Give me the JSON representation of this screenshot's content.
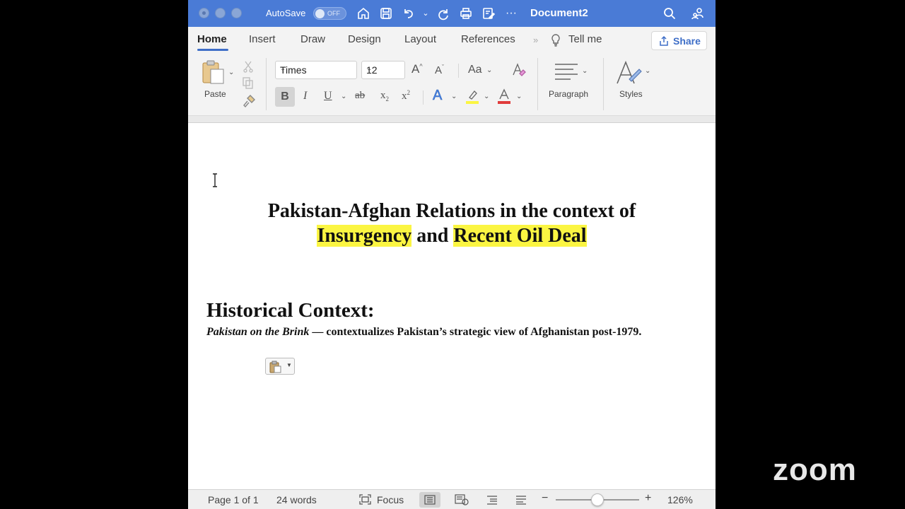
{
  "titlebar": {
    "autosave_label": "AutoSave",
    "autosave_state": "OFF",
    "document_title": "Document2",
    "accent_color": "#4a7bd6"
  },
  "tabs": {
    "items": [
      "Home",
      "Insert",
      "Draw",
      "Design",
      "Layout",
      "References"
    ],
    "active": "Home",
    "tell_me": "Tell me",
    "share_label": "Share"
  },
  "ribbon": {
    "paste_label": "Paste",
    "font_name": "Times",
    "font_size": "12",
    "case_label": "Aa",
    "paragraph_label": "Paragraph",
    "styles_label": "Styles",
    "highlight_color": "#fbf542",
    "font_color": "#e03b3b"
  },
  "document": {
    "title_line1": "Pakistan-Afghan Relations in the context of",
    "title_hl1": "Insurgency",
    "title_and": "and",
    "title_hl2": "Recent Oil Deal",
    "heading": "Historical Context:",
    "para_italic": "Pakistan on the Brink",
    "para_dash": "—",
    "para_rest": "contextualizes Pakistan’s strategic view of Afghanistan post-1979."
  },
  "status": {
    "page": "Page 1 of 1",
    "words": "24 words",
    "focus": "Focus",
    "zoom_level": "126%",
    "zoom_fraction": 0.5
  },
  "overlay": {
    "zoom_watermark": "zoom"
  }
}
